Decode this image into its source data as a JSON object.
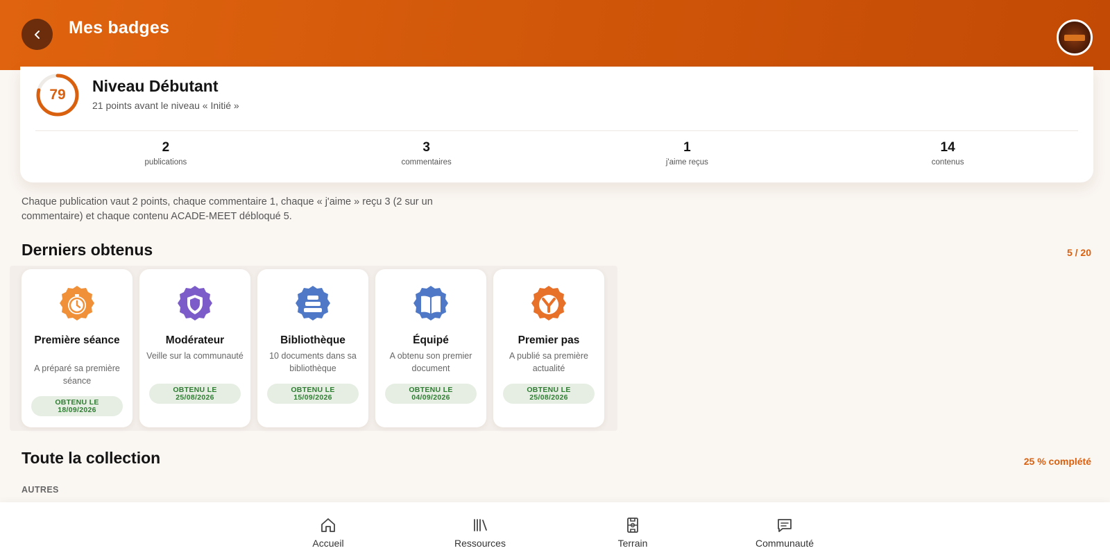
{
  "header": {
    "title": "Mes badges"
  },
  "level": {
    "score": "79",
    "progress": 0.79,
    "title": "Niveau Débutant",
    "subtitle": "21 points avant le niveau « Initié »",
    "stats": [
      {
        "value": "2",
        "label": "publications"
      },
      {
        "value": "3",
        "label": "commentaires"
      },
      {
        "value": "1",
        "label": "j'aime reçus"
      },
      {
        "value": "14",
        "label": "contenus"
      }
    ]
  },
  "info_text": "Chaque publication vaut 2 points, chaque commentaire 1, chaque « j'aime » reçu 3 (2 sur un commentaire) et chaque contenu ACADE-MEET débloqué 5.",
  "recent": {
    "title": "Derniers obtenus",
    "count": "5 / 20",
    "badges": [
      {
        "name": "Première séance",
        "desc": "A préparé sa première séance",
        "chip_line1": "OBTENU LE",
        "chip_line2": "18/09/2026",
        "icon": "stopwatch-icon",
        "color": "#f0913a"
      },
      {
        "name": "Modérateur",
        "desc": "Veille sur la communauté",
        "chip_line1": "OBTENU LE",
        "chip_line2": "25/08/2026",
        "icon": "shield-icon",
        "color": "#7b5cc9"
      },
      {
        "name": "Bibliothèque",
        "desc": "10 documents dans sa bibliothèque",
        "chip_line1": "OBTENU LE",
        "chip_line2": "15/09/2026",
        "icon": "books-stack-icon",
        "color": "#4f79c7"
      },
      {
        "name": "Équipé",
        "desc": "A obtenu son premier document",
        "chip_line1": "OBTENU LE",
        "chip_line2": "04/09/2026",
        "icon": "open-book-icon",
        "color": "#4f79c7"
      },
      {
        "name": "Premier pas",
        "desc": "A publié sa première actualité",
        "chip_line1": "OBTENU LE",
        "chip_line2": "25/08/2026",
        "icon": "y-sign-icon",
        "color": "#e8712a"
      }
    ]
  },
  "collection": {
    "title": "Toute la collection",
    "completion": "25 % complété",
    "category": "AUTRES"
  },
  "nav": {
    "items": [
      {
        "label": "Accueil",
        "icon": "home-icon"
      },
      {
        "label": "Ressources",
        "icon": "library-icon"
      },
      {
        "label": "Terrain",
        "icon": "field-icon"
      },
      {
        "label": "Communauté",
        "icon": "chat-icon"
      }
    ]
  },
  "colors": {
    "brand": "#d9600f",
    "chip_text": "#2e7d32",
    "chip_bg": "#e6eee3"
  }
}
